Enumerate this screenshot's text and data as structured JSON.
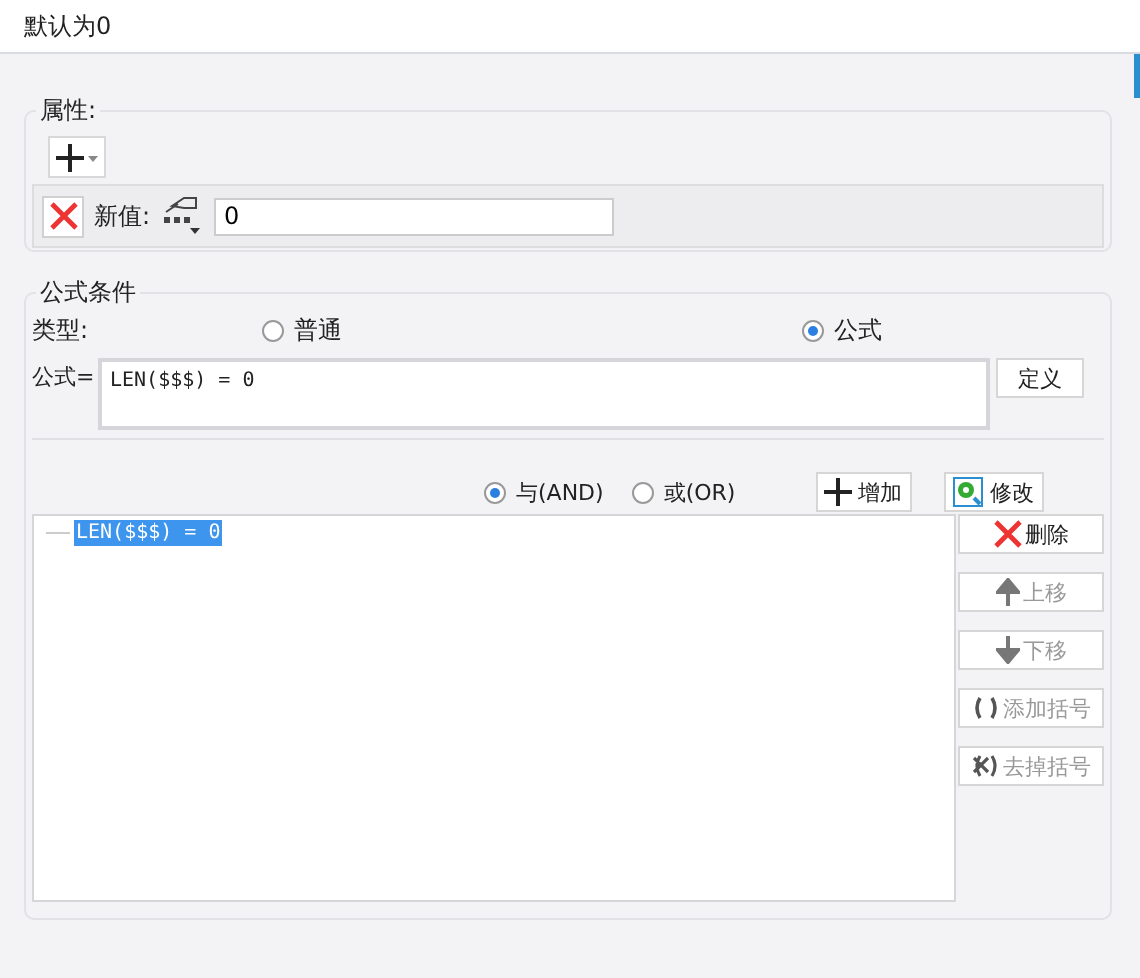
{
  "title": "默认为0",
  "attributes": {
    "legend": "属性:",
    "rows": [
      {
        "label": "新值:",
        "value": "0"
      }
    ]
  },
  "formula_condition": {
    "legend": "公式条件",
    "type_label": "类型:",
    "types": [
      {
        "label": "普通",
        "selected": false
      },
      {
        "label": "公式",
        "selected": true
      }
    ],
    "formula_label": "公式=",
    "formula": "LEN($$$) = 0",
    "define_button": "定义",
    "logic": [
      {
        "label": "与(AND)",
        "selected": true
      },
      {
        "label": "或(OR)",
        "selected": false
      }
    ],
    "add_button": "增加",
    "modify_button": "修改",
    "conditions": [
      {
        "text": "LEN($$$) = 0",
        "selected": true
      }
    ],
    "actions": [
      {
        "kind": "delete",
        "label": "删除",
        "disabled": false
      },
      {
        "kind": "up",
        "label": "上移",
        "disabled": true
      },
      {
        "kind": "down",
        "label": "下移",
        "disabled": true
      },
      {
        "kind": "add-brackets",
        "label": "添加括号",
        "disabled": true
      },
      {
        "kind": "remove-brackets",
        "label": "去掉括号",
        "disabled": true
      }
    ]
  }
}
